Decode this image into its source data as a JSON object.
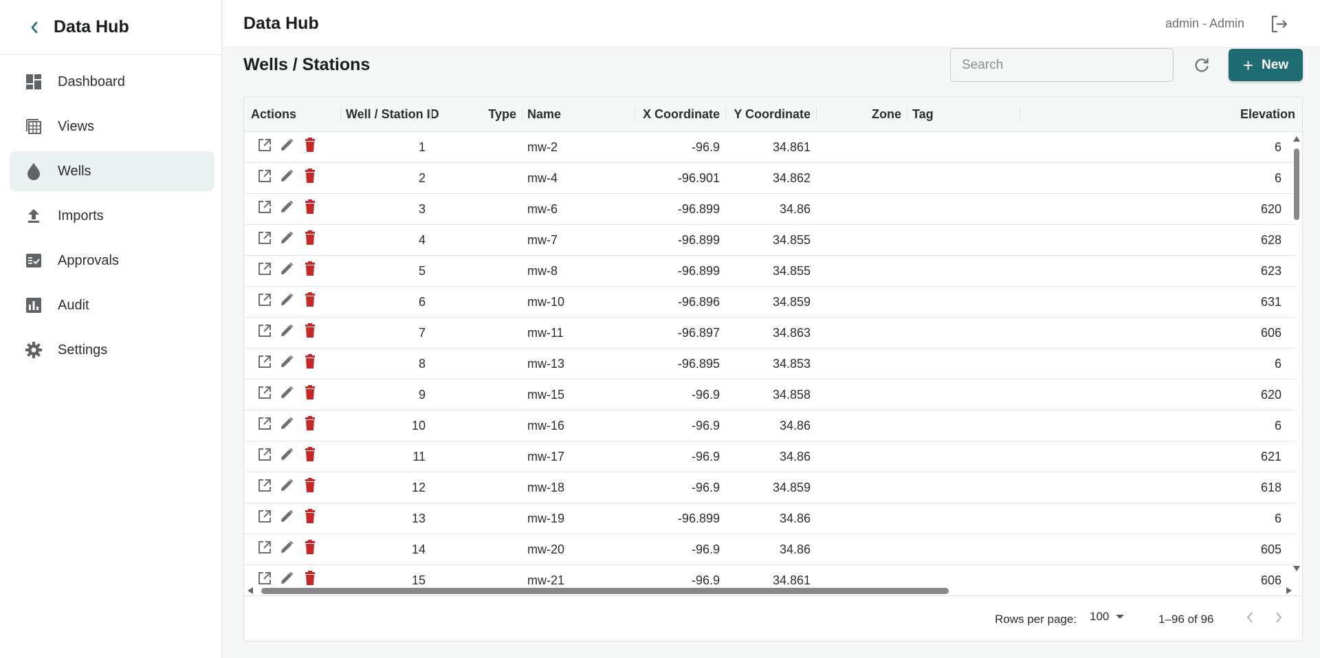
{
  "sidebar": {
    "title": "Data Hub",
    "items": [
      {
        "label": "Dashboard",
        "icon": "dashboard-icon"
      },
      {
        "label": "Views",
        "icon": "views-icon"
      },
      {
        "label": "Wells",
        "icon": "water-drop-icon",
        "active": true
      },
      {
        "label": "Imports",
        "icon": "upload-icon"
      },
      {
        "label": "Approvals",
        "icon": "approvals-icon"
      },
      {
        "label": "Audit",
        "icon": "bar-chart-icon"
      },
      {
        "label": "Settings",
        "icon": "gear-icon"
      }
    ]
  },
  "header": {
    "title": "Data Hub",
    "user": "admin - Admin"
  },
  "page": {
    "title": "Wells / Stations",
    "search_placeholder": "Search",
    "search_value": "",
    "new_label": "New"
  },
  "colors": {
    "accent": "#1f6b72",
    "delete": "#c62828",
    "active_nav": "#eaf1f0"
  },
  "table": {
    "columns": [
      "Actions",
      "Well / Station ID",
      "Type",
      "Name",
      "X Coordinate",
      "Y Coordinate",
      "Zone",
      "Tag",
      "Elevation"
    ],
    "rows": [
      {
        "id": "1",
        "type": "",
        "name": "mw-2",
        "x": "-96.9",
        "y": "34.861",
        "zone": "",
        "tag": "",
        "elev": "6"
      },
      {
        "id": "2",
        "type": "",
        "name": "mw-4",
        "x": "-96.901",
        "y": "34.862",
        "zone": "",
        "tag": "",
        "elev": "6"
      },
      {
        "id": "3",
        "type": "",
        "name": "mw-6",
        "x": "-96.899",
        "y": "34.86",
        "zone": "",
        "tag": "",
        "elev": "620"
      },
      {
        "id": "4",
        "type": "",
        "name": "mw-7",
        "x": "-96.899",
        "y": "34.855",
        "zone": "",
        "tag": "",
        "elev": "628"
      },
      {
        "id": "5",
        "type": "",
        "name": "mw-8",
        "x": "-96.899",
        "y": "34.855",
        "zone": "",
        "tag": "",
        "elev": "623"
      },
      {
        "id": "6",
        "type": "",
        "name": "mw-10",
        "x": "-96.896",
        "y": "34.859",
        "zone": "",
        "tag": "",
        "elev": "631"
      },
      {
        "id": "7",
        "type": "",
        "name": "mw-11",
        "x": "-96.897",
        "y": "34.863",
        "zone": "",
        "tag": "",
        "elev": "606"
      },
      {
        "id": "8",
        "type": "",
        "name": "mw-13",
        "x": "-96.895",
        "y": "34.853",
        "zone": "",
        "tag": "",
        "elev": "6"
      },
      {
        "id": "9",
        "type": "",
        "name": "mw-15",
        "x": "-96.9",
        "y": "34.858",
        "zone": "",
        "tag": "",
        "elev": "620"
      },
      {
        "id": "10",
        "type": "",
        "name": "mw-16",
        "x": "-96.9",
        "y": "34.86",
        "zone": "",
        "tag": "",
        "elev": "6"
      },
      {
        "id": "11",
        "type": "",
        "name": "mw-17",
        "x": "-96.9",
        "y": "34.86",
        "zone": "",
        "tag": "",
        "elev": "621"
      },
      {
        "id": "12",
        "type": "",
        "name": "mw-18",
        "x": "-96.9",
        "y": "34.859",
        "zone": "",
        "tag": "",
        "elev": "618"
      },
      {
        "id": "13",
        "type": "",
        "name": "mw-19",
        "x": "-96.899",
        "y": "34.86",
        "zone": "",
        "tag": "",
        "elev": "6"
      },
      {
        "id": "14",
        "type": "",
        "name": "mw-20",
        "x": "-96.9",
        "y": "34.86",
        "zone": "",
        "tag": "",
        "elev": "605"
      },
      {
        "id": "15",
        "type": "",
        "name": "mw-21",
        "x": "-96.9",
        "y": "34.861",
        "zone": "",
        "tag": "",
        "elev": "606"
      }
    ]
  },
  "pagination": {
    "rows_per_page_label": "Rows per page:",
    "rows_per_page": "100",
    "range": "1–96 of 96"
  }
}
